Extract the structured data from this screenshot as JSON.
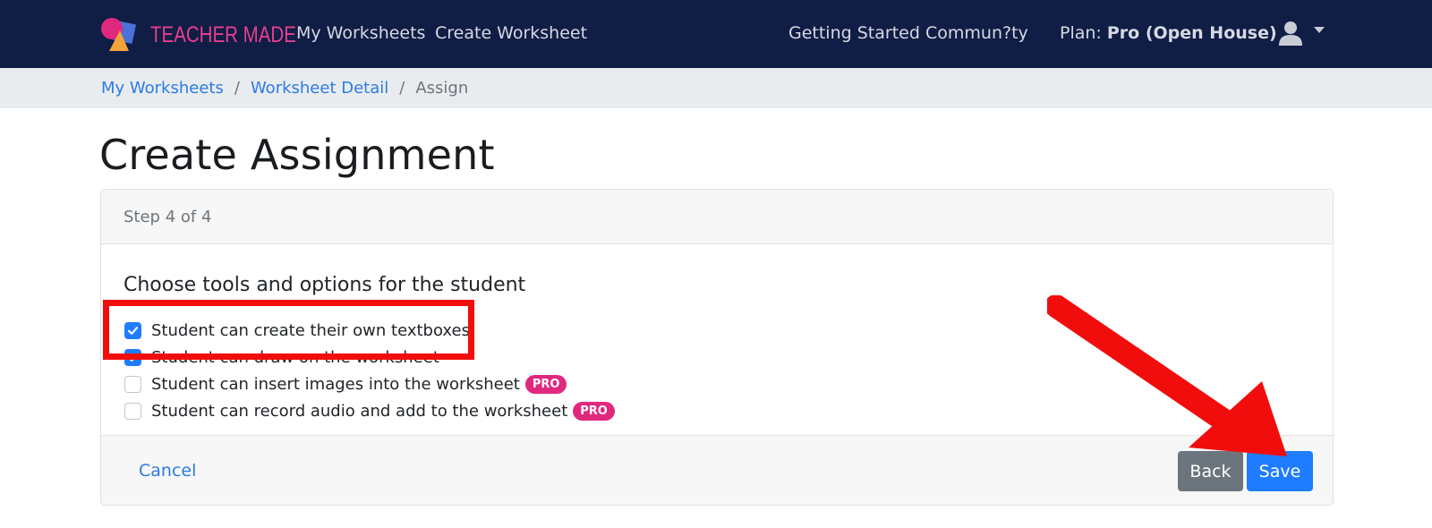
{
  "navbar": {
    "brand": "TEACHER MADE",
    "links": [
      {
        "label": "My Worksheets"
      },
      {
        "label": "Create Worksheet"
      },
      {
        "label": "Getting Started"
      },
      {
        "label": "Commun?ty"
      }
    ],
    "plan_prefix": "Plan:",
    "plan_name": "Pro (Open House)",
    "user_icon": "user-icon"
  },
  "breadcrumb": {
    "items": [
      {
        "label": "My Worksheets"
      },
      {
        "label": "Worksheet Detail"
      },
      {
        "label": "Assign"
      }
    ],
    "separator": "/"
  },
  "page": {
    "title": "Create Assignment"
  },
  "card": {
    "step": "Step 4 of 4",
    "options_title": "Choose tools and options for the student",
    "options": [
      {
        "label": "Student can create their own textboxes",
        "checked": true,
        "badge": ""
      },
      {
        "label": "Student can draw on the worksheet",
        "checked": true,
        "badge": ""
      },
      {
        "label": "Student can insert images into the worksheet",
        "checked": false,
        "badge": "PRO"
      },
      {
        "label": "Student can record audio and add to the worksheet",
        "checked": false,
        "badge": "PRO"
      }
    ],
    "footer": {
      "cancel": "Cancel",
      "back": "Back",
      "save": "Save"
    }
  },
  "colors": {
    "navbar_bg": "#101d45",
    "brand": "#e63f8f",
    "link": "#2c7be5",
    "primary": "#1f7cff",
    "secondary": "#6c757d",
    "pro_badge": "#e0287f",
    "annotation_red": "#f20d0d"
  }
}
